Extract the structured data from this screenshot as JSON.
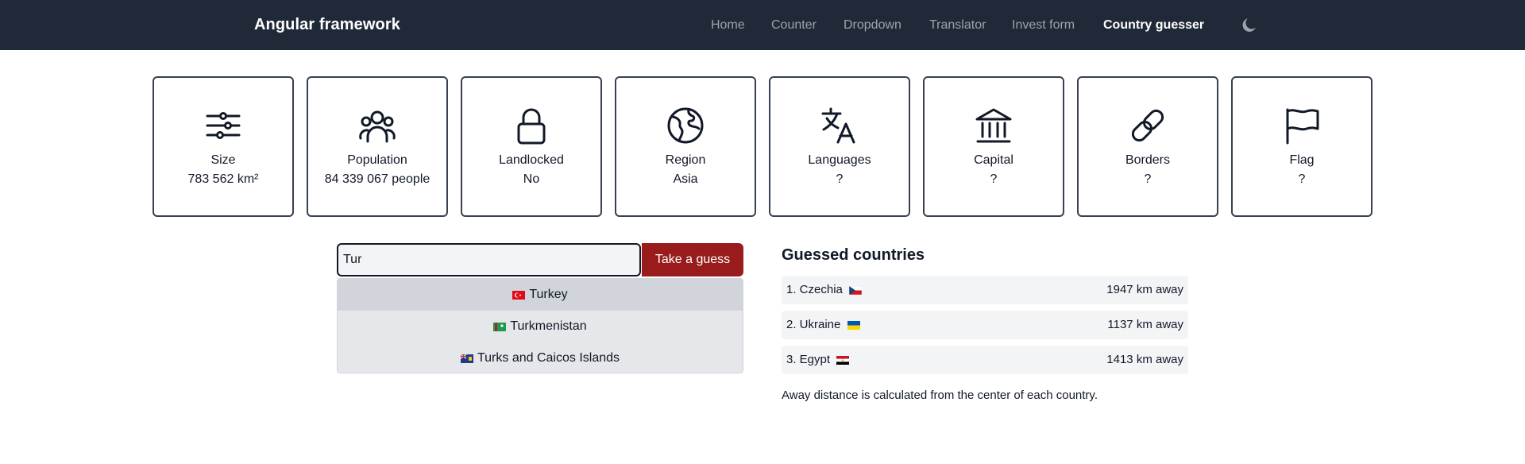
{
  "app": {
    "brand": "Angular framework"
  },
  "nav": {
    "items": [
      {
        "label": "Home"
      },
      {
        "label": "Counter"
      },
      {
        "label": "Dropdown"
      },
      {
        "label": "Translator"
      },
      {
        "label": "Invest form"
      },
      {
        "label": "Country guesser",
        "active": true
      }
    ],
    "theme_icon": "moon-icon"
  },
  "hints": [
    {
      "icon": "sliders-icon",
      "label": "Size",
      "value": "783 562 km²"
    },
    {
      "icon": "users-icon",
      "label": "Population",
      "value": "84 339 067 people"
    },
    {
      "icon": "lock-icon",
      "label": "Landlocked",
      "value": "No"
    },
    {
      "icon": "globe-icon",
      "label": "Region",
      "value": "Asia"
    },
    {
      "icon": "translate-icon",
      "label": "Languages",
      "value": "?"
    },
    {
      "icon": "bank-icon",
      "label": "Capital",
      "value": "?"
    },
    {
      "icon": "link-icon",
      "label": "Borders",
      "value": "?"
    },
    {
      "icon": "flag-icon",
      "label": "Flag",
      "value": "?"
    }
  ],
  "guess": {
    "input_value": "Tur",
    "button_label": "Take a guess",
    "suggestions": [
      {
        "name": "Turkey",
        "flag": "turkey-flag-icon",
        "highlighted": true
      },
      {
        "name": "Turkmenistan",
        "flag": "turkmenistan-flag-icon"
      },
      {
        "name": "Turks and Caicos Islands",
        "flag": "turks-caicos-flag-icon"
      }
    ]
  },
  "guessed": {
    "title": "Guessed countries",
    "items": [
      {
        "name": "1. Czechia",
        "flag": "czechia-flag-icon",
        "distance": "1947 km away"
      },
      {
        "name": "2. Ukraine",
        "flag": "ukraine-flag-icon",
        "distance": "1137 km away"
      },
      {
        "name": "3. Egypt",
        "flag": "egypt-flag-icon",
        "distance": "1413 km away"
      }
    ],
    "footnote": "Away distance is calculated from the center of each country."
  },
  "colors": {
    "navbar": "#1f2937",
    "accent_button": "#991b1b",
    "card_border": "#374151"
  }
}
